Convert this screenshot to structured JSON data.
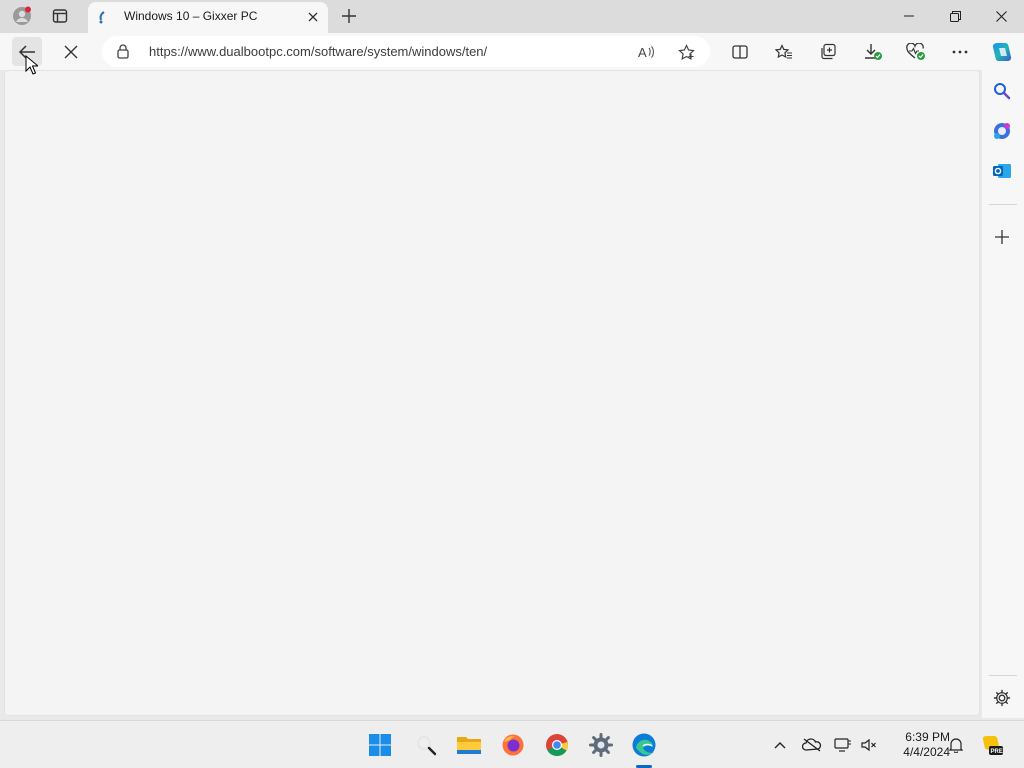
{
  "browser": {
    "tab": {
      "title": "Windows 10 – Gixxer PC",
      "favicon": "page-favicon-icon"
    },
    "address": {
      "url": "https://www.dualbootpc.com/software/system/windows/ten/"
    },
    "toolbar_icons": [
      "back-arrow-icon",
      "stop-loading-icon",
      "read-aloud-icon",
      "favorite-star-icon",
      "split-screen-icon",
      "favorites-icon",
      "collections-icon",
      "downloads-icon",
      "browser-essentials-icon",
      "more-menu-icon",
      "copilot-icon"
    ],
    "sidebar_icons": [
      "search-icon",
      "copilot-hub-icon",
      "outlook-icon",
      "add-icon",
      "settings-icon"
    ],
    "accent_color": "#0b67c2"
  },
  "taskbar": {
    "apps": [
      "start-icon",
      "search-icon",
      "file-explorer-icon",
      "firefox-icon",
      "chrome-icon",
      "settings-icon",
      "edge-icon"
    ],
    "clock": {
      "time": "6:39 PM",
      "date": "4/4/2024"
    }
  }
}
